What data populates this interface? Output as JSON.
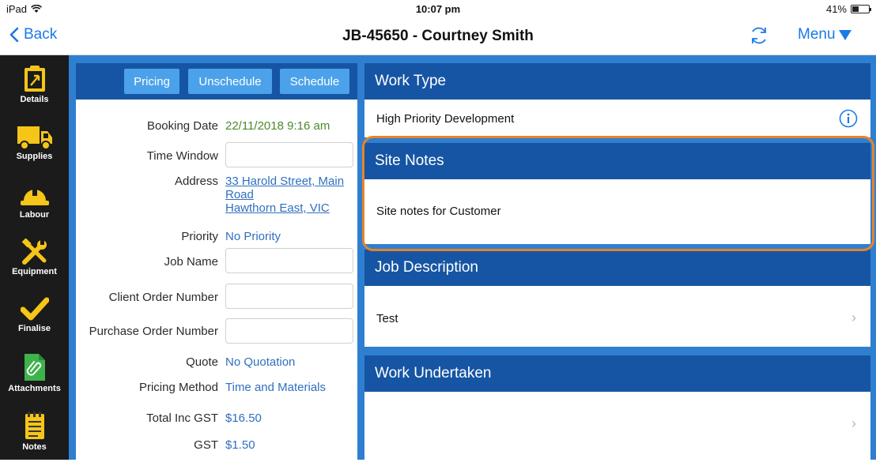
{
  "status_bar": {
    "device": "iPad",
    "time": "10:07 pm",
    "battery": "41%",
    "battery_level": 0.41
  },
  "nav": {
    "back_label": "Back",
    "title": "JB-45650 - Courtney Smith",
    "menu_label": "Menu",
    "refresh_icon": "refresh-icon"
  },
  "sidebar": {
    "items": [
      {
        "label": "Details",
        "icon": "clipboard-icon"
      },
      {
        "label": "Supplies",
        "icon": "truck-icon"
      },
      {
        "label": "Labour",
        "icon": "hardhat-icon"
      },
      {
        "label": "Equipment",
        "icon": "tools-icon"
      },
      {
        "label": "Finalise",
        "icon": "checkmark-icon"
      },
      {
        "label": "Attachments",
        "icon": "paperclip-icon"
      },
      {
        "label": "Notes",
        "icon": "notepad-icon"
      }
    ]
  },
  "toolbar": {
    "pricing_label": "Pricing",
    "unschedule_label": "Unschedule",
    "schedule_label": "Schedule"
  },
  "form": {
    "booking_date_label": "Booking Date",
    "booking_date_value": "22/11/2018 9:16 am",
    "time_window_label": "Time Window",
    "time_window_value": "",
    "address_label": "Address",
    "address_line1": "33 Harold Street, Main",
    "address_line2": "Road",
    "address_line3": "Hawthorn East, VIC",
    "priority_label": "Priority",
    "priority_value": "No Priority",
    "job_name_label": "Job Name",
    "job_name_value": "",
    "client_order_label": "Client Order Number",
    "client_order_value": "",
    "purchase_order_label": "Purchase Order Number",
    "purchase_order_value": "",
    "quote_label": "Quote",
    "quote_value": "No Quotation",
    "pricing_method_label": "Pricing Method",
    "pricing_method_value": "Time and Materials",
    "total_label": "Total Inc GST",
    "total_value": "$16.50",
    "gst_label": "GST",
    "gst_value": "$1.50"
  },
  "sections": {
    "work_type": {
      "title": "Work Type",
      "value": "High Priority Development"
    },
    "site_notes": {
      "title": "Site Notes",
      "value": "Site notes for Customer"
    },
    "job_description": {
      "title": "Job Description",
      "value": "Test"
    },
    "work_undertaken": {
      "title": "Work Undertaken",
      "value": ""
    }
  },
  "colors": {
    "accent": "#1a7ae6",
    "header_blue": "#1655a3",
    "button_blue": "#4ba2ea",
    "highlight": "#e8832a",
    "sidebar": "#1b1b1b"
  }
}
